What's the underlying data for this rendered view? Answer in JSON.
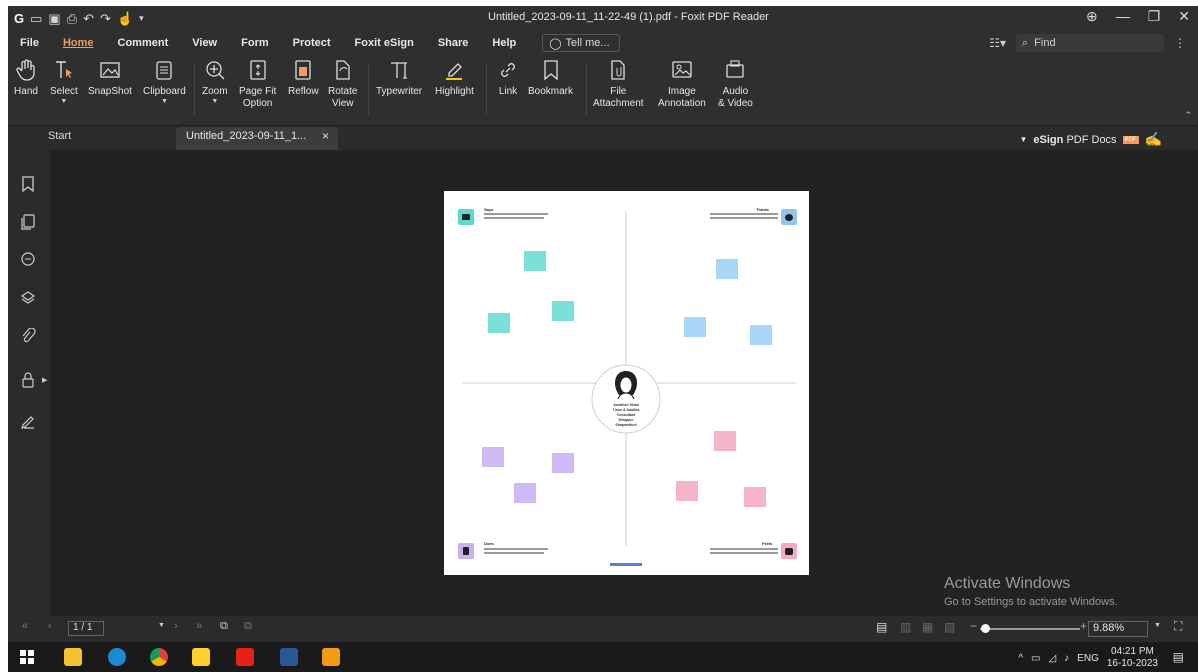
{
  "titlebar": {
    "title": "Untitled_2023-09-11_11-22-49 (1).pdf - Foxit PDF Reader"
  },
  "menu": {
    "items": [
      "File",
      "Home",
      "Comment",
      "View",
      "Form",
      "Protect",
      "Foxit eSign",
      "Share",
      "Help"
    ],
    "active": "Home",
    "tell_me": "Tell me...",
    "find_placeholder": "Find"
  },
  "ribbon": {
    "hand": "Hand",
    "select": "Select",
    "snapshot": "SnapShot",
    "clipboard": "Clipboard",
    "zoom": "Zoom",
    "page_fit_1": "Page Fit",
    "page_fit_2": "Option",
    "reflow": "Reflow",
    "rotate_1": "Rotate",
    "rotate_2": "View",
    "typewriter": "Typewriter",
    "highlight": "Highlight",
    "link": "Link",
    "bookmark": "Bookmark",
    "file_att_1": "File",
    "file_att_2": "Attachment",
    "image_ann_1": "Image",
    "image_ann_2": "Annotation",
    "audio_1": "Audio",
    "audio_2": "& Video"
  },
  "tabs": {
    "start": "Start",
    "doc": "Untitled_2023-09-11_1...",
    "close": "×",
    "esign_bold": "eSign",
    "esign_rest": "PDF Docs"
  },
  "page": {
    "says": "Says",
    "thinks": "Thinks",
    "does": "Does",
    "feels": "Feels",
    "center_text": "Jonathon Shaw Tinon & Adaltita Consultant Whapper Shapmethod"
  },
  "status": {
    "page": "1 / 1",
    "zoom": "9.88%"
  },
  "watermark": {
    "line1": "Activate Windows",
    "line2": "Go to Settings to activate Windows."
  },
  "tray": {
    "lang": "ENG",
    "time": "04:21 PM",
    "date": "16-10-2023"
  }
}
